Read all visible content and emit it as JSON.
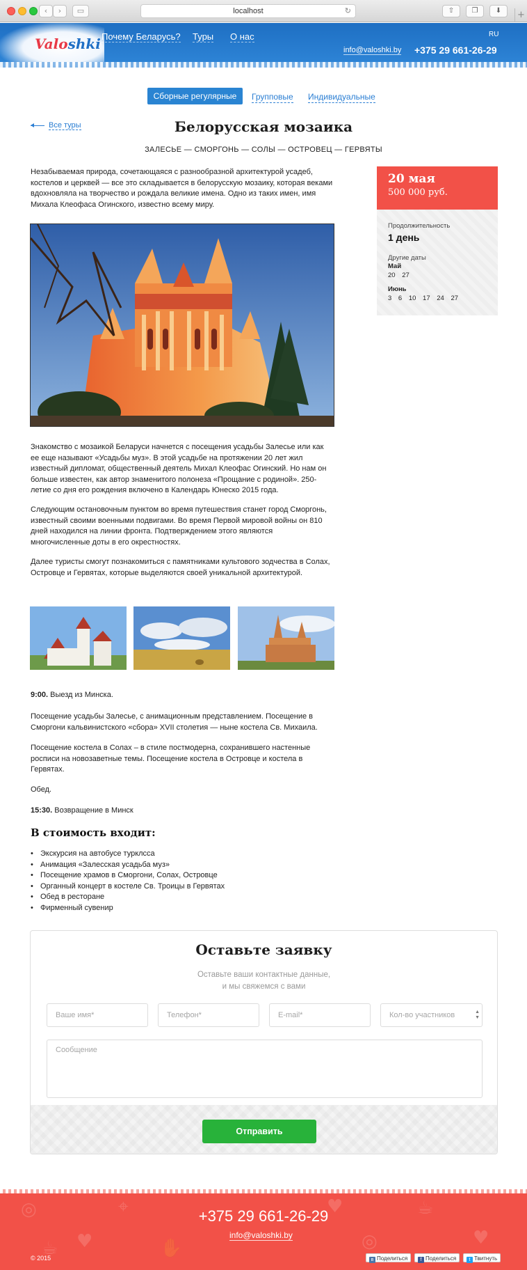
{
  "browser": {
    "url": "localhost",
    "back_icon": "chevron-left-icon",
    "forward_icon": "chevron-right-icon"
  },
  "header": {
    "logo_part1": "Valo",
    "logo_part2": "shki",
    "menu": [
      "Почему Беларусь?",
      "Туры",
      "О нас"
    ],
    "lang": "RU",
    "email": "info@valoshki.by",
    "phone": "+375 29 661-26-29"
  },
  "tabs": [
    "Сборные регулярные",
    "Групповые",
    "Индивидуальные"
  ],
  "back_link": "Все туры",
  "tour": {
    "title": "Белорусская мозаика",
    "route": "ЗАЛЕСЬЕ — СМОРГОНЬ — СОЛЫ — ОСТРОВЕЦ — ГЕРВЯТЫ",
    "intro": "Незабываемая природа, сочетающаяся с разнообразной архитектурой усадеб, костелов и церквей — все это складывается в белорусскую мозаику, которая веками вдохновляла на творчество и рождала великие имена. Одно из таких имен, имя Михала Клеофаса Огинского, известно всему миру.",
    "p1": "Знакомство с мозаикой Беларуси начнется с посещения усадьбы Залесье или как ее еще называют «Усадьбы муз». В этой усадьбе на протяжении 20 лет жил известный дипломат, общественный деятель Михал Клеофас Огинский. Но нам он больше известен, как автор знаменитого полонеза «Прощание с родиной». 250-летие со дня его рождения включено в Календарь Юнеско 2015 года.",
    "p2": "Следующим остановочным пунктом во время путешествия станет город Сморгонь, известный своими военными подвигами. Во время Первой мировой войны он 810 дней находился на линии фронта. Подтверждением этого являются многочисленные доты в его окрестностях.",
    "p3": "Далее туристы смогут познакомиться с памятниками культового зодчества в Солах, Островце и Гервятах, которые выделяются своей уникальной архитектурой.",
    "schedule": {
      "s1_time": "9:00.",
      "s1_text": " Выезд из Минска.",
      "s2": "Посещение усадьбы Залесье, с анимационным представлением. Посещение в Сморгони кальвинистского «сбора» XVII столетия — ныне костела Св. Михаила.",
      "s3": "Посещение костела в Солах – в стиле постмодерна, сохранившего настенные росписи на новозаветные темы. Посещение костела в Островце и костела в Гервятах.",
      "s4": "Обед.",
      "s5_time": "15:30.",
      "s5_text": " Возвращение в Минск"
    },
    "includes_title": "В стоимость входит:",
    "includes": [
      "Экскурсия на автобусе турклсса",
      "Анимация «Залесская усадьба муз»",
      "Посещение храмов в Сморгони, Солах, Островце",
      "Органный концерт в костеле Св. Троицы в Гервятах",
      "Обед в ресторане",
      "Фирменный сувенир"
    ]
  },
  "price_card": {
    "date": "20 мая",
    "price": "500 000 руб.",
    "duration_label": "Продолжительность",
    "duration": "1 день",
    "other_dates_label": "Другие даты",
    "months": [
      {
        "name": "Май",
        "days": "20 27"
      },
      {
        "name": "Июнь",
        "days": "3 6 10 17 24 27"
      }
    ]
  },
  "form": {
    "title": "Оставьте заявку",
    "subtitle_line1": "Оставьте ваши контактные данные,",
    "subtitle_line2": "и мы свяжемся с вами",
    "name_placeholder": "Ваше имя*",
    "phone_placeholder": "Телефон*",
    "email_placeholder": "E-mail*",
    "count_placeholder": "Кол-во участников",
    "message_placeholder": "Сообщение",
    "submit": "Отправить"
  },
  "footer": {
    "phone": "+375 29 661-26-29",
    "email": "info@valoshki.by",
    "copyright": "© 2015",
    "share_vk": "Поделиться",
    "share_fb": "Поделиться",
    "share_tw": "Твитнуть"
  },
  "colors": {
    "header_blue": "#1e6fc3",
    "accent_red": "#f25148",
    "link_blue": "#2a7ed3",
    "submit_green": "#28b23a"
  },
  "tour_fixed": "Белорусская мозаика"
}
